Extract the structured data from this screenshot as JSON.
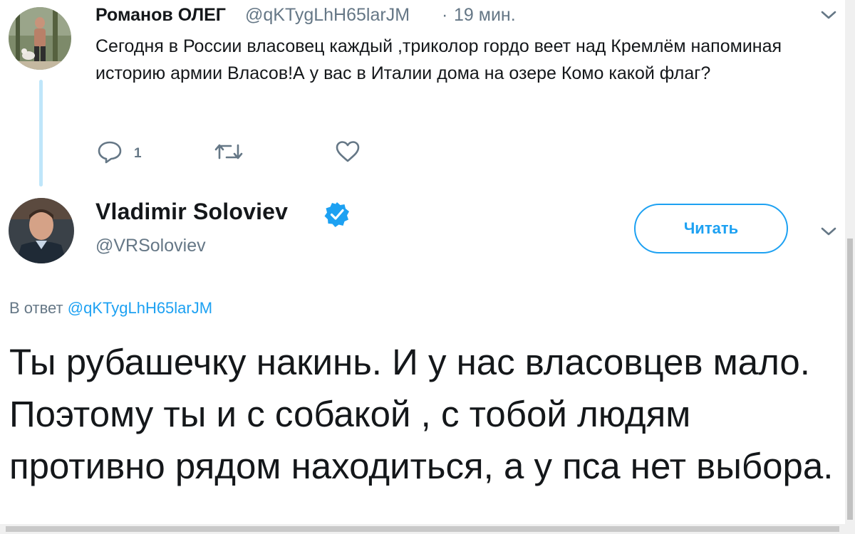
{
  "parent_tweet": {
    "author_name": "Романов ОЛЕГ",
    "author_handle": "@qKTygLhH65larJM",
    "separator": "·",
    "time": "19 мин.",
    "text": "Сегодня в России власовец каждый ,триколор гордо веет над Кремлём напоминая историю армии Власов!А у вас в Италии дома на озере Комо какой флаг?",
    "reply_count": "1",
    "icons": {
      "reply": "reply-icon",
      "retweet": "retweet-icon",
      "like": "heart-icon",
      "menu": "chevron-down-icon"
    }
  },
  "main_tweet": {
    "display_name": "Vladimir Soloviev",
    "handle": "@VRSoloviev",
    "verified": true,
    "follow_label": "Читать",
    "reply_prefix": "В ответ",
    "reply_mention": "@qKTygLhH65larJM",
    "text": "Ты рубашечку накинь. И у нас власовцев мало. Поэтому ты и с собакой , с тобой людям противно рядом находиться, а у пса нет выбора."
  },
  "colors": {
    "accent": "#1da1f2",
    "muted": "#657786",
    "text": "#14171a",
    "thread_line": "#bfe6fa"
  }
}
